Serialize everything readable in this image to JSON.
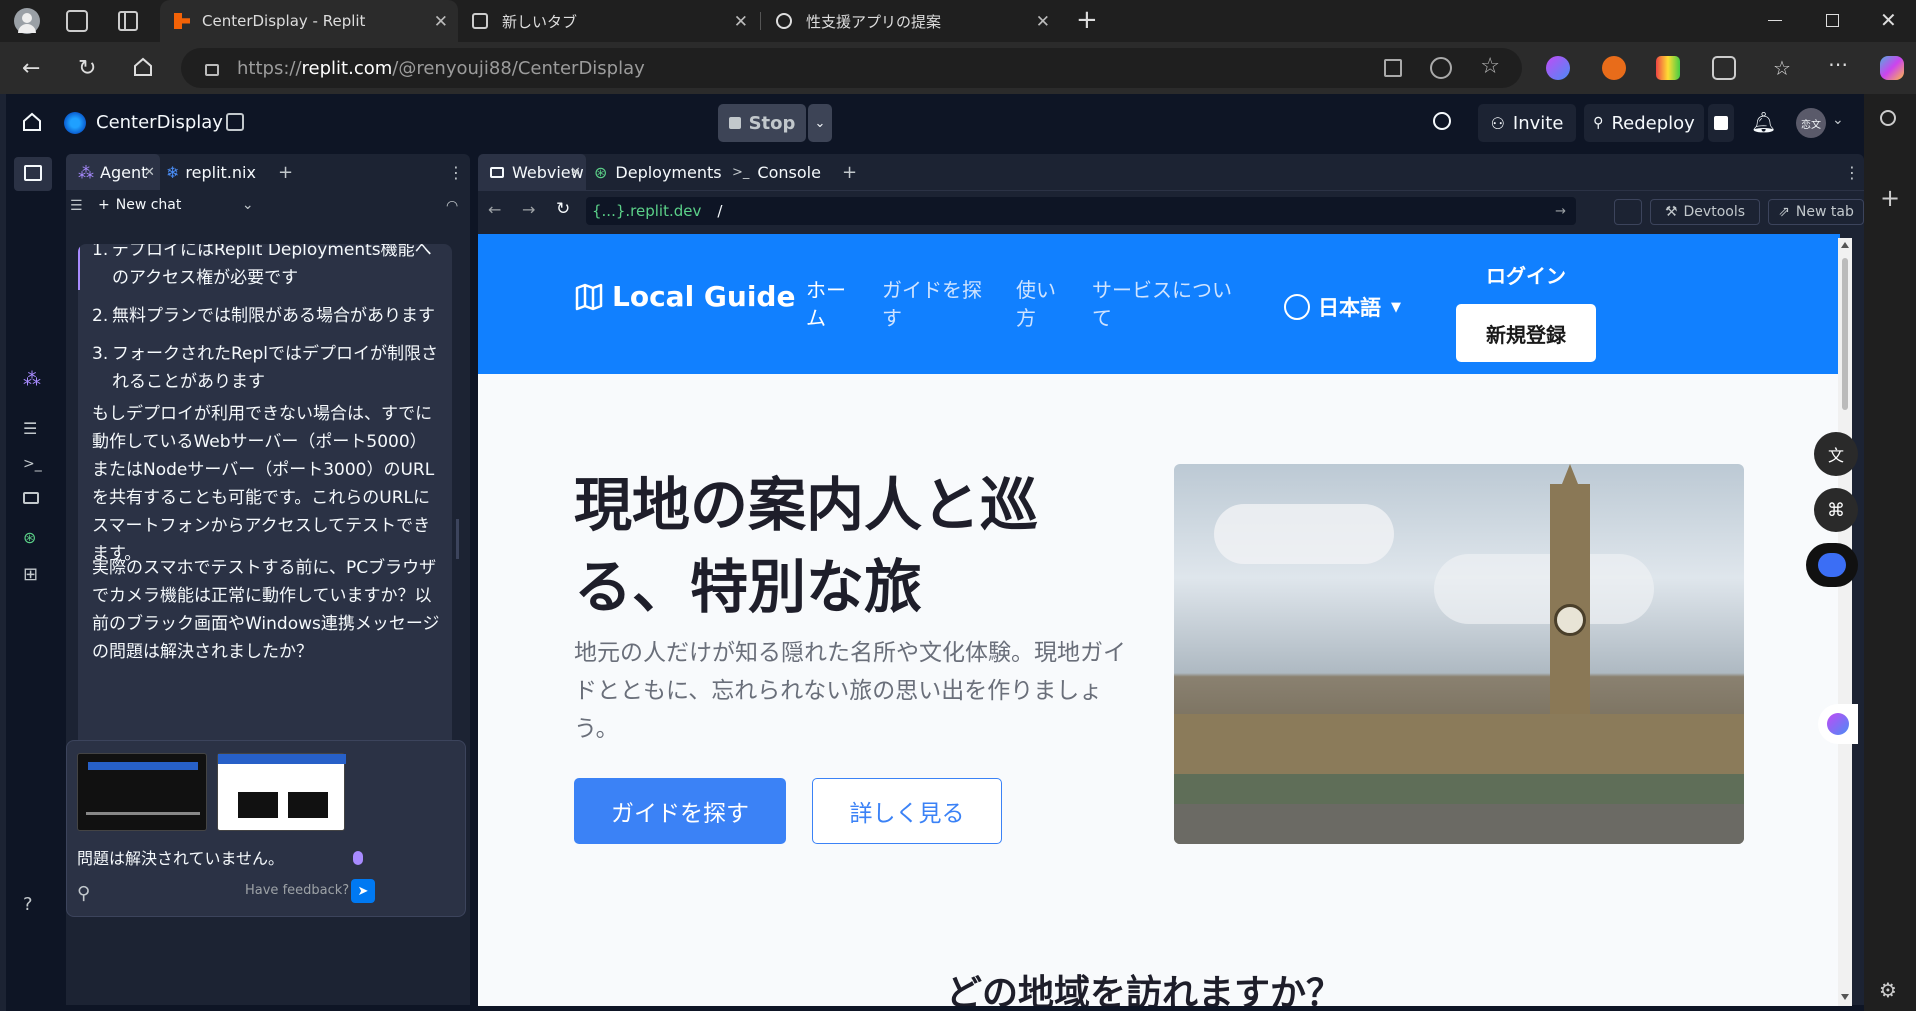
{
  "browser": {
    "tabs": [
      {
        "title": "CenterDisplay - Replit",
        "icon": "replit-icon",
        "active": true
      },
      {
        "title": "新しいタブ",
        "icon": "newtab-icon",
        "active": false
      },
      {
        "title": "性支援アプリの提案",
        "icon": "chatgpt-icon",
        "active": false
      }
    ],
    "url_prefix": "https://",
    "url_domain": "replit.com",
    "url_path": "/@renyouji88/CenterDisplay"
  },
  "replit": {
    "project_name": "CenterDisplay",
    "stop_label": "Stop",
    "invite_label": "Invite",
    "redeploy_label": "Redeploy",
    "left_tabs": [
      "Agent",
      "replit.nix"
    ],
    "new_chat_label": "New chat",
    "right_tabs": [
      "Webview",
      "Deployments",
      "Console"
    ],
    "webview_domain": "{...}.replit.dev",
    "webview_path": "/",
    "devtools_label": "Devtools",
    "newtab_label": "New tab",
    "avatar_label": "恋文",
    "help_label": "?"
  },
  "chat": {
    "list_items": [
      {
        "num": "1.",
        "text": "デプロイにはReplit Deployments機能へのアクセス権が必要です"
      },
      {
        "num": "2.",
        "text": "無料プランでは制限がある場合があります"
      },
      {
        "num": "3.",
        "text": "フォークされたReplではデプロイが制限されることがあります"
      }
    ],
    "para1": "もしデプロイが利用できない場合は、すでに動作しているWebサーバー（ポート5000）またはNodeサーバー（ポート3000）のURLを共有することも可能です。これらのURLにスマートフォンからアクセスしてテストできます。",
    "para2": "実際のスマホでテストする前に、PCブラウザでカメラ機能は正常に動作していますか？以前のブラック画面やWindows連携メッセージの問題は解決されましたか？",
    "input_text": "問題は解決されていません。",
    "feedback_label": "Have feedback?"
  },
  "site": {
    "logo": "Local Guide",
    "nav": [
      "ホーム",
      "ガイドを探す",
      "使い方",
      "サービスについて"
    ],
    "lang": "日本語",
    "login": "ログイン",
    "signup": "新規登録",
    "hero_title": "現地の案内人と巡る、特別な旅",
    "hero_text": "地元の人だけが知る隠れた名所や文化体験。現地ガイドとともに、忘れられない旅の思い出を作りましょう。",
    "btn_primary": "ガイドを探す",
    "btn_secondary": "詳しく見る",
    "section_title": "どの地域を訪れますか？"
  },
  "colors": {
    "accent": "#1180ff",
    "replit_bg": "#0e1525",
    "replit_panel": "#1c2333",
    "btn_blue": "#3b82f6"
  }
}
